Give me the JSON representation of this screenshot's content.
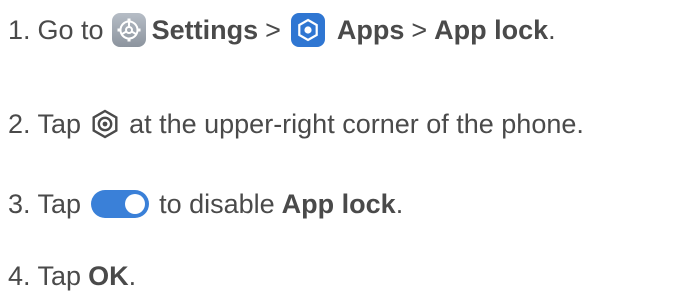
{
  "steps": [
    {
      "num": "1.",
      "go_to": "Go to",
      "settings": "Settings",
      "sep1": ">",
      "apps": "Apps",
      "sep2": ">",
      "app_lock": "App lock",
      "end": ".",
      "icons": [
        "settings-gear-icon",
        "apps-hexagon-icon"
      ]
    },
    {
      "num": "2.",
      "tap": "Tap",
      "rest": "at the upper-right corner of the phone.",
      "icons": [
        "hexagon-settings-icon"
      ]
    },
    {
      "num": "3.",
      "tap": "Tap",
      "rest": "to disable",
      "app_lock": "App lock",
      "end": ".",
      "icons": [
        "toggle-on-icon"
      ],
      "toggle_color": "#3a80d8"
    },
    {
      "num": "4.",
      "tap": "Tap",
      "ok": "OK",
      "end": "."
    }
  ],
  "colors": {
    "text": "#4a4a4a",
    "settings_icon_bg": "#9aa2ac",
    "apps_icon_bg": "#2f76d2",
    "toggle": "#3a80d8"
  }
}
